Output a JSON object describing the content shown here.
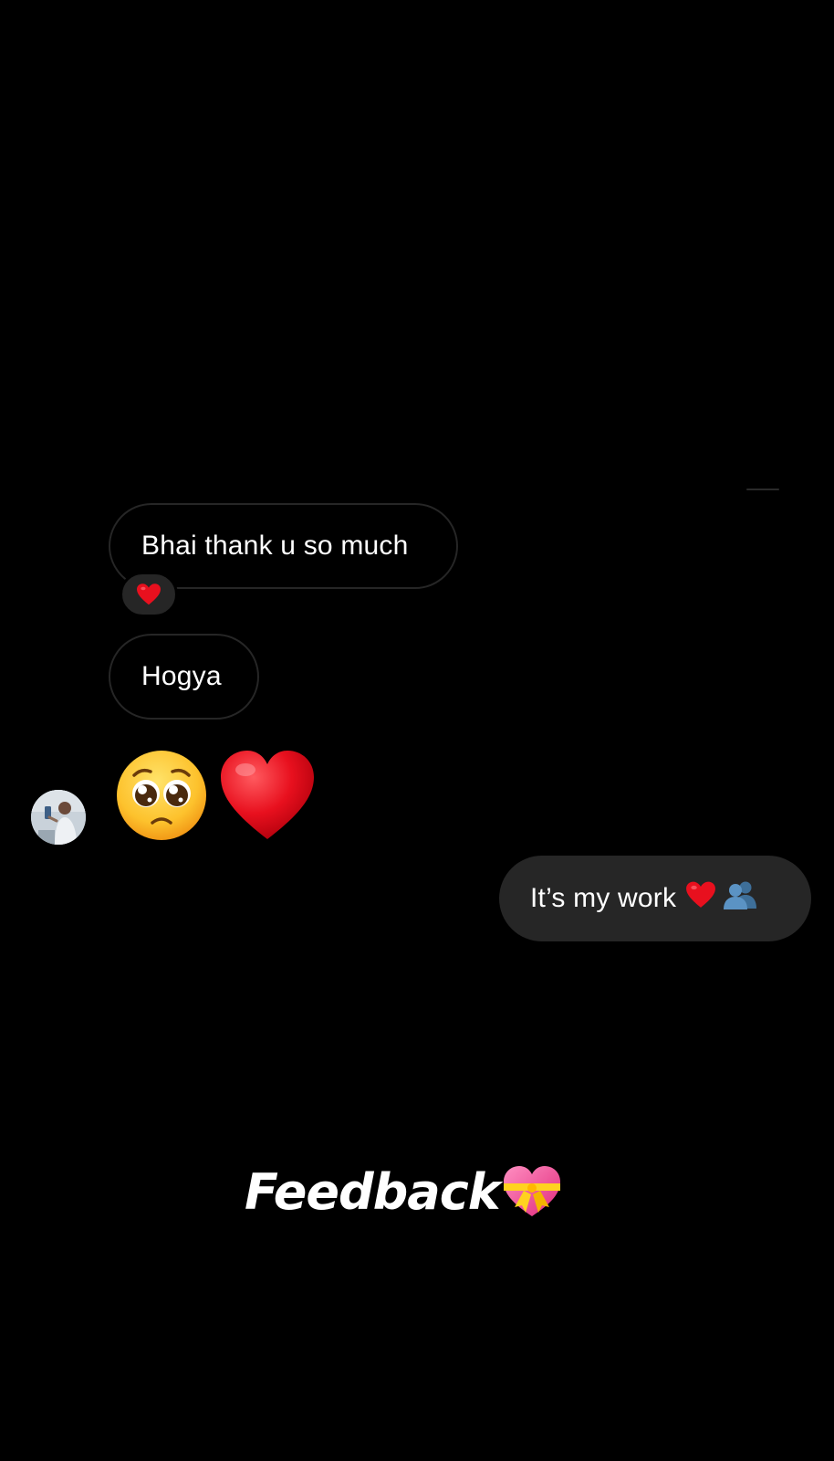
{
  "conversation": {
    "messages": [
      {
        "text": "Bhai thank u so much",
        "direction": "received",
        "reaction": "red-heart"
      },
      {
        "text": "Hogya",
        "direction": "received"
      },
      {
        "emojis": [
          "pleading-face",
          "red-heart"
        ],
        "direction": "received",
        "avatar": "contact-avatar"
      },
      {
        "text": "It’s my work",
        "emojis": [
          "red-heart",
          "busts-in-silhouette"
        ],
        "direction": "sent"
      }
    ]
  },
  "overlay": {
    "caption": "Feedback",
    "caption_emoji": "heart-with-ribbon"
  },
  "colors": {
    "background": "#000000",
    "sent_bubble": "#262626",
    "received_border": "#262626",
    "heart": "#e8101e"
  }
}
